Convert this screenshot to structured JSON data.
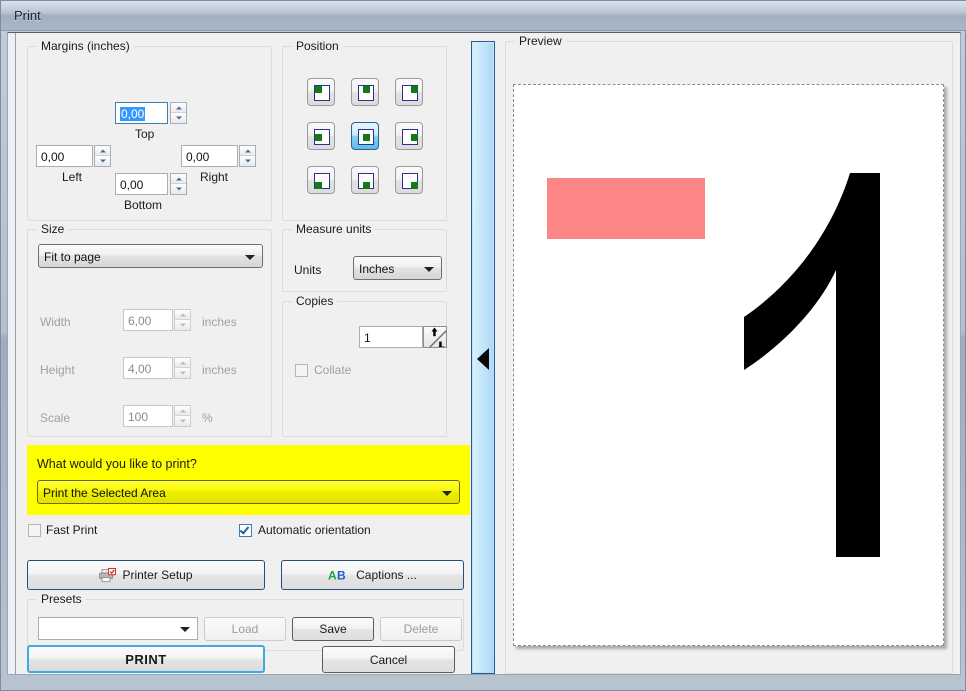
{
  "window": {
    "title": "Print"
  },
  "margins": {
    "group_title": "Margins (inches)",
    "top_value": "0,00",
    "top_label": "Top",
    "left_value": "0,00",
    "left_label": "Left",
    "right_value": "0,00",
    "right_label": "Right",
    "bottom_value": "0,00",
    "bottom_label": "Bottom"
  },
  "position": {
    "group_title": "Position",
    "selected_index": 4,
    "cells": [
      "top-left",
      "top-center",
      "top-right",
      "middle-left",
      "middle-center",
      "middle-right",
      "bottom-left",
      "bottom-center",
      "bottom-right"
    ]
  },
  "size": {
    "group_title": "Size",
    "mode_value": "Fit to page",
    "width_label": "Width",
    "width_value": "6,00",
    "width_units": "inches",
    "height_label": "Height",
    "height_value": "4,00",
    "height_units": "inches",
    "scale_label": "Scale",
    "scale_value": "100",
    "scale_units": "%"
  },
  "measure_units": {
    "group_title": "Measure units",
    "units_label": "Units",
    "units_value": "Inches"
  },
  "copies": {
    "group_title": "Copies",
    "count_value": "1",
    "collate_label": "Collate",
    "collate_checked": false
  },
  "print_what": {
    "question": "What would you like to print?",
    "selected": "Print the Selected Area"
  },
  "options": {
    "fast_print_label": "Fast Print",
    "fast_print_checked": false,
    "auto_orientation_label": "Automatic orientation",
    "auto_orientation_checked": true
  },
  "actions": {
    "printer_setup_label": "Printer Setup",
    "captions_label": "Captions ...",
    "print_label": "PRINT",
    "cancel_label": "Cancel"
  },
  "presets": {
    "group_title": "Presets",
    "selected": "",
    "load_label": "Load",
    "save_label": "Save",
    "delete_label": "Delete"
  },
  "preview": {
    "group_title": "Preview",
    "page_content": {
      "rectangle_color": "#fc8686",
      "digit": "1"
    }
  },
  "colors": {
    "highlight_yellow": "#ffff00",
    "focus_blue": "#3fa9e0",
    "splitter_blue": "#bfe3fb",
    "pink_rect": "#fc8686",
    "position_marker_green": "#157a15"
  }
}
